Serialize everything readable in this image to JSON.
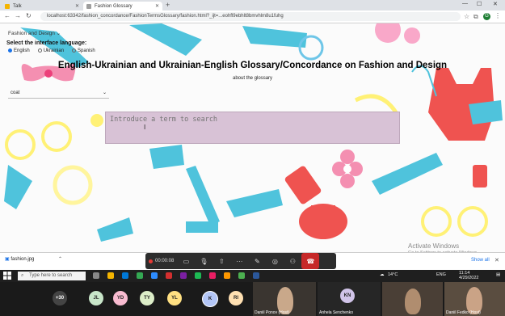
{
  "browser": {
    "tabs": [
      {
        "label": "Talk",
        "favicon_color": "#f4b400"
      },
      {
        "label": "Fashion Glossary",
        "favicon_color": "#9e9e9e"
      }
    ],
    "url": "localhost:63342/fashion_concordance/FashionTermsGlossary/fashion.html?_ijt=...eohfl9ebhlt8bmvhlm8u1fuhg"
  },
  "page": {
    "top_dropdown": "Fashion and Design",
    "interface_language_title": "Select the interface language:",
    "interface_languages": [
      {
        "label": "English",
        "selected": true
      },
      {
        "label": "Ukrainian",
        "selected": false
      },
      {
        "label": "Spanish",
        "selected": false
      }
    ],
    "title": "English-Ukrainian and Ukrainian-English Glossary/Concordance on Fashion and Design",
    "about_link": "about the glossary",
    "language_select_value": "coat",
    "search_placeholder": "Introduce a term to search",
    "watermark_title": "Activate Windows",
    "watermark_sub": "Go to Settings to activate Windows."
  },
  "downloads": {
    "file": "fashion.jpg",
    "show_all": "Show all"
  },
  "zoom": {
    "timer": "00:00:08"
  },
  "taskbar": {
    "search_placeholder": "Type here to search",
    "temperature": "14°C",
    "language": "ENG",
    "time": "11:14",
    "date": "4/29/2022"
  },
  "participants": {
    "more_count": "+30",
    "initials": [
      {
        "text": "JL",
        "color": "#c8e6c9"
      },
      {
        "text": "YD",
        "color": "#f8bbd0"
      },
      {
        "text": "TY",
        "color": "#dcedc8"
      },
      {
        "text": "YL",
        "color": "#ffe082"
      },
      {
        "text": "K",
        "color": "#b3c6f7"
      },
      {
        "text": "RI",
        "color": "#ffe0b2"
      },
      {
        "text": "KN",
        "color": "#d1c4e9"
      }
    ],
    "videos": [
      "Daniil Ponov (Host)",
      "Anhela Senchenko",
      "Daniil Fedko (Host)"
    ]
  }
}
